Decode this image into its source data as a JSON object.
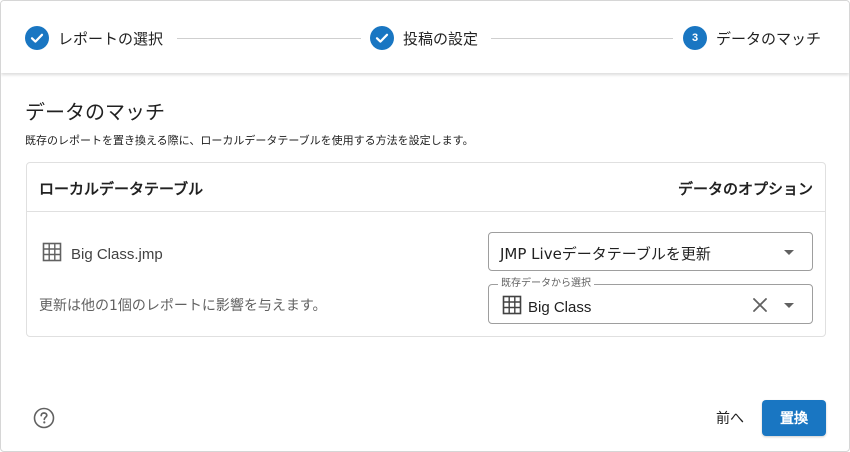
{
  "stepper": {
    "steps": [
      {
        "label": "レポートの選択",
        "state": "completed"
      },
      {
        "label": "投稿の設定",
        "state": "completed"
      },
      {
        "label": "データのマッチ",
        "state": "active",
        "number": "3"
      }
    ]
  },
  "page": {
    "title": "データのマッチ",
    "description": "既存のレポートを置き換える際に、ローカルデータテーブルを使用する方法を設定します。"
  },
  "table": {
    "header_left": "ローカルデータテーブル",
    "header_right": "データのオプション",
    "row": {
      "file_name": "Big Class.jmp",
      "note": "更新は他の1個のレポートに影響を与えます。",
      "option_select": {
        "value": "JMP Liveデータテーブルを更新"
      },
      "existing_select": {
        "label": "既存データから選択",
        "value": "Big Class"
      }
    }
  },
  "footer": {
    "back_label": "前へ",
    "replace_label": "置換"
  },
  "colors": {
    "accent": "#1976c2",
    "border": "#9e9e9e",
    "muted_text": "#616161"
  },
  "icons": {
    "check": "check-icon",
    "table": "table-icon",
    "clear": "close-icon",
    "dropdown": "chevron-down-icon",
    "help": "help-circle-icon"
  }
}
